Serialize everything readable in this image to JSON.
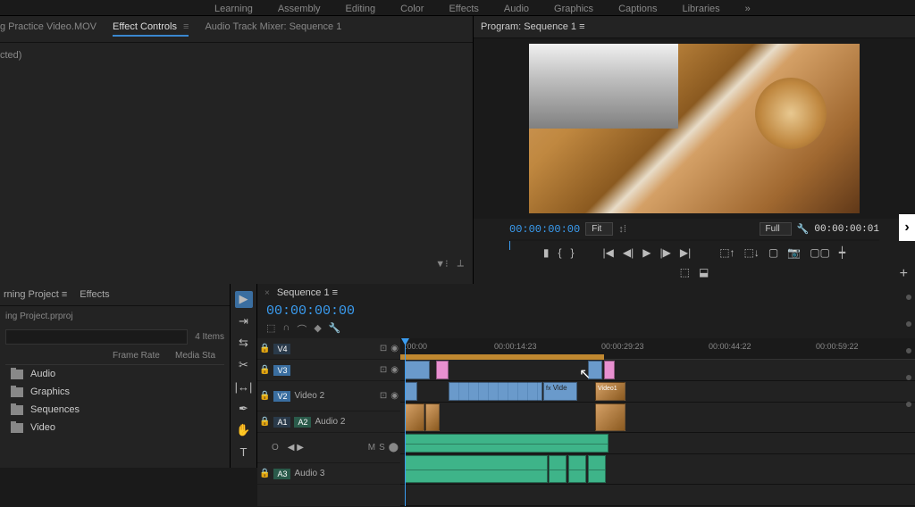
{
  "workspaces": [
    "Learning",
    "Assembly",
    "Editing",
    "Color",
    "Effects",
    "Audio",
    "Graphics",
    "Captions",
    "Libraries"
  ],
  "source_panel": {
    "tabs": [
      {
        "label": "g Practice Video.MOV"
      },
      {
        "label": "Effect Controls"
      },
      {
        "label": "Audio Track Mixer: Sequence 1"
      }
    ],
    "selected_text": "cted)"
  },
  "program": {
    "tab": "Program: Sequence 1",
    "timecode": "00:00:00:00",
    "fit": "Fit",
    "zoom": "Full",
    "timecode_right": "00:00:00:01"
  },
  "project": {
    "tabs": [
      {
        "label": "rning Project"
      },
      {
        "label": "Effects"
      }
    ],
    "filename": "ing Project.prproj",
    "items_count": "4 Items",
    "columns": [
      "",
      "Frame Rate",
      "Media Sta"
    ],
    "bins": [
      "Audio",
      "Graphics",
      "Sequences",
      "Video"
    ]
  },
  "timeline": {
    "sequence_name": "Sequence 1",
    "timecode": "00:00:00:00",
    "ruler_ticks": [
      {
        "pos": 5,
        "label": ":00:00"
      },
      {
        "pos": 165,
        "label": "00:00:14:23"
      },
      {
        "pos": 330,
        "label": "00:00:29:23"
      },
      {
        "pos": 495,
        "label": "00:00:44:22"
      },
      {
        "pos": 660,
        "label": "00:00:59:22"
      }
    ],
    "tracks": {
      "v4": "V4",
      "v3": "V3",
      "v2": {
        "label": "V2",
        "name": "Video 2"
      },
      "a1": "A1",
      "a2": {
        "label": "A2",
        "name": "Audio 2"
      },
      "a3": {
        "label": "A3",
        "name": "Audio 3"
      }
    },
    "clips_v3_label1": "Vide",
    "clips_v3_label2": "Video1"
  }
}
